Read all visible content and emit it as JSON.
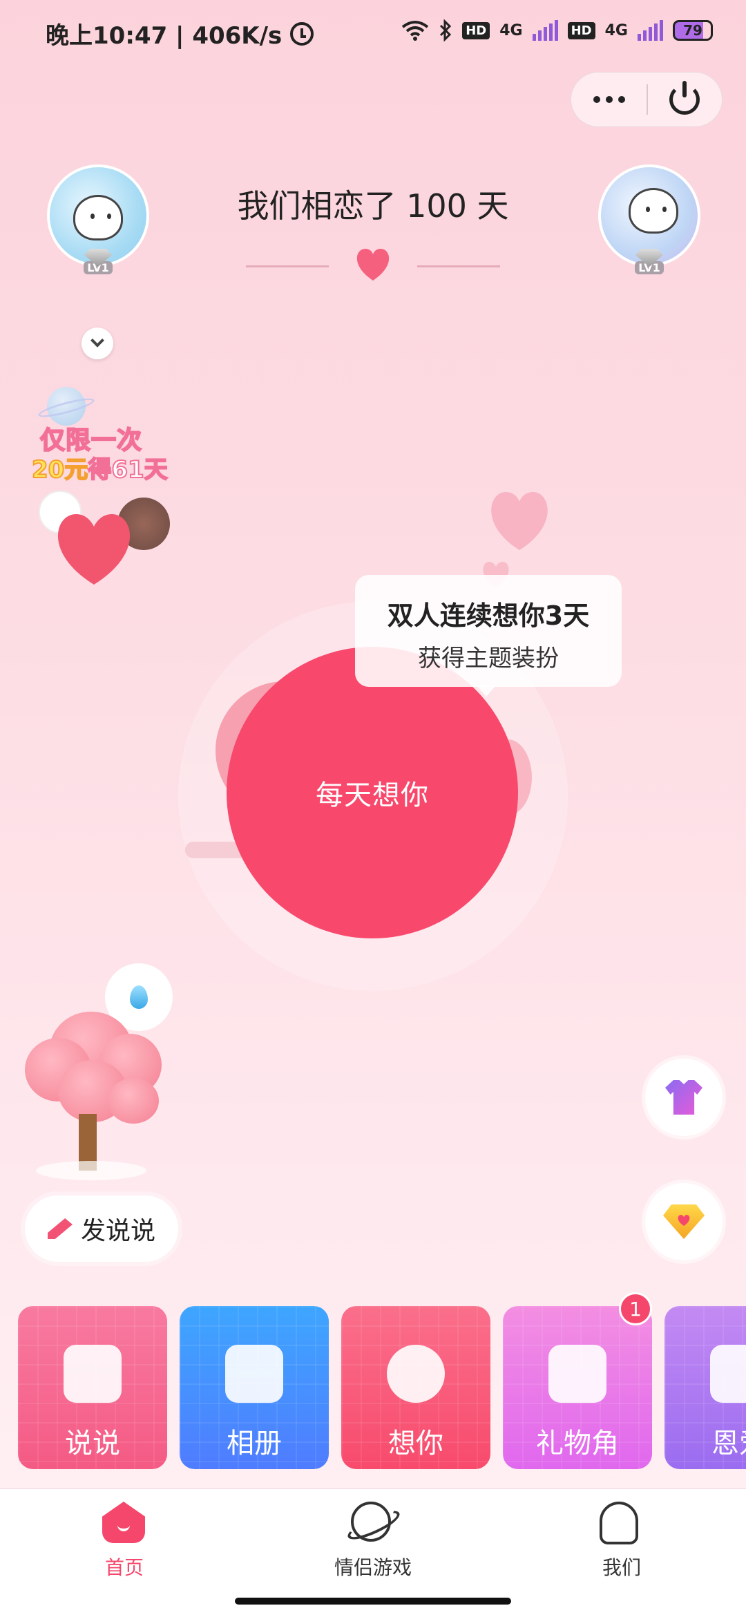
{
  "status_bar": {
    "time": "晚上10:47 | 406K/s",
    "network_hd1": "HD",
    "network_4g1": "4G",
    "network_hd2": "HD",
    "network_4g2": "4G",
    "battery": "79"
  },
  "capsule": {
    "more_icon": "more-icon",
    "power_icon": "power-icon"
  },
  "couple": {
    "title": "我们相恋了 100 天",
    "left_level": "LV1",
    "right_level": "LV1"
  },
  "promo": {
    "line1": "仅限一次",
    "line2_price": "20元",
    "line2_rest": "得61天"
  },
  "main": {
    "button_label": "每天想你",
    "tip_line1": "双人连续想你3天",
    "tip_line2": "获得主题装扮"
  },
  "post_button": {
    "label": "发说说"
  },
  "cards": [
    {
      "label": "说说",
      "color": "#f66a92"
    },
    {
      "label": "相册",
      "color": "#4f8cff"
    },
    {
      "label": "想你",
      "color": "#f9597a"
    },
    {
      "label": "礼物角",
      "color": "#e77ae8"
    },
    {
      "label": "恩爱",
      "color": "#a87af0"
    }
  ],
  "gift_badge": "1",
  "tabs": [
    {
      "label": "首页",
      "active": true
    },
    {
      "label": "情侣游戏",
      "active": false
    },
    {
      "label": "我们",
      "active": false
    }
  ],
  "colors": {
    "accent": "#f8486c",
    "background_top": "#fcd3dc",
    "background_bottom": "#fff1f4"
  }
}
